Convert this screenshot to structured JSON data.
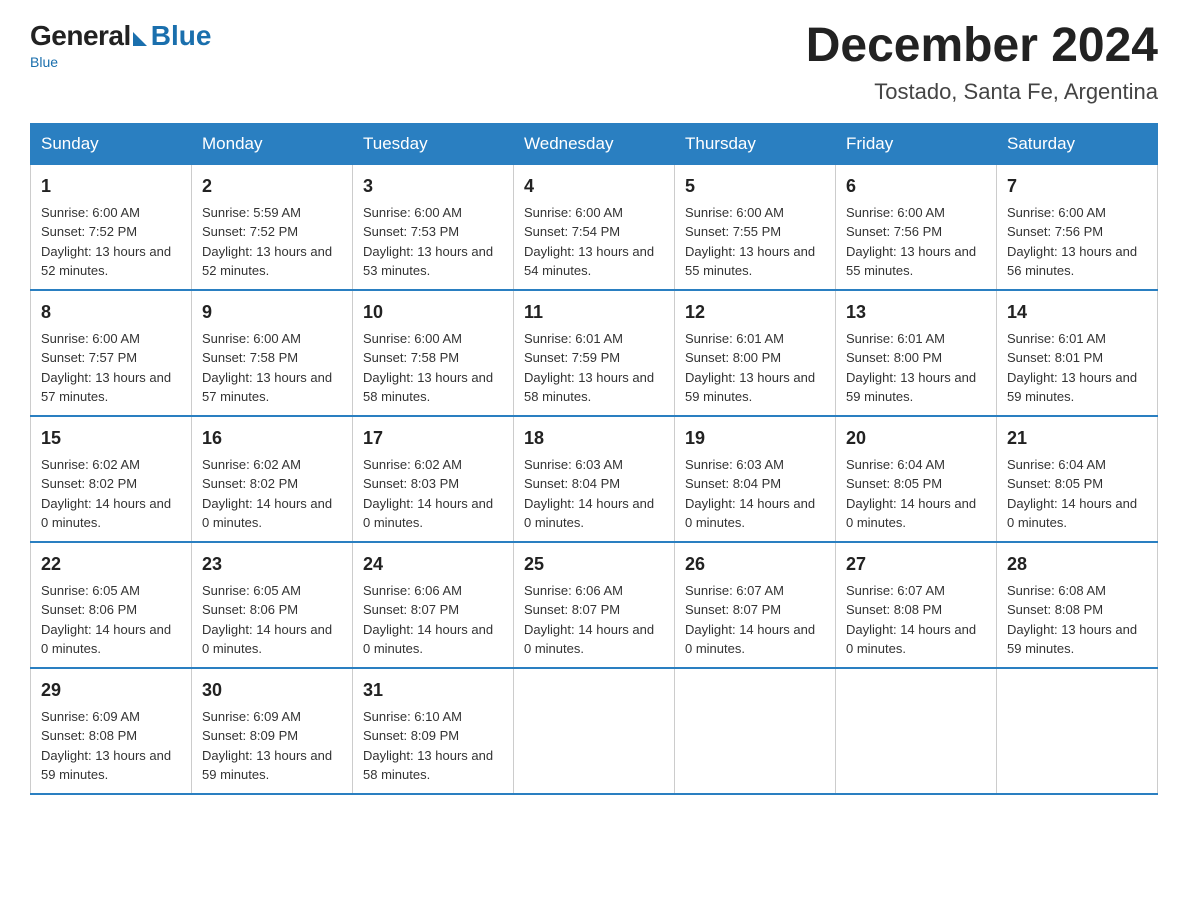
{
  "logo": {
    "general": "General",
    "blue": "Blue",
    "subtitle": "Blue"
  },
  "title": "December 2024",
  "subtitle": "Tostado, Santa Fe, Argentina",
  "days_of_week": [
    "Sunday",
    "Monday",
    "Tuesday",
    "Wednesday",
    "Thursday",
    "Friday",
    "Saturday"
  ],
  "weeks": [
    [
      {
        "day": "1",
        "sunrise": "Sunrise: 6:00 AM",
        "sunset": "Sunset: 7:52 PM",
        "daylight": "Daylight: 13 hours and 52 minutes."
      },
      {
        "day": "2",
        "sunrise": "Sunrise: 5:59 AM",
        "sunset": "Sunset: 7:52 PM",
        "daylight": "Daylight: 13 hours and 52 minutes."
      },
      {
        "day": "3",
        "sunrise": "Sunrise: 6:00 AM",
        "sunset": "Sunset: 7:53 PM",
        "daylight": "Daylight: 13 hours and 53 minutes."
      },
      {
        "day": "4",
        "sunrise": "Sunrise: 6:00 AM",
        "sunset": "Sunset: 7:54 PM",
        "daylight": "Daylight: 13 hours and 54 minutes."
      },
      {
        "day": "5",
        "sunrise": "Sunrise: 6:00 AM",
        "sunset": "Sunset: 7:55 PM",
        "daylight": "Daylight: 13 hours and 55 minutes."
      },
      {
        "day": "6",
        "sunrise": "Sunrise: 6:00 AM",
        "sunset": "Sunset: 7:56 PM",
        "daylight": "Daylight: 13 hours and 55 minutes."
      },
      {
        "day": "7",
        "sunrise": "Sunrise: 6:00 AM",
        "sunset": "Sunset: 7:56 PM",
        "daylight": "Daylight: 13 hours and 56 minutes."
      }
    ],
    [
      {
        "day": "8",
        "sunrise": "Sunrise: 6:00 AM",
        "sunset": "Sunset: 7:57 PM",
        "daylight": "Daylight: 13 hours and 57 minutes."
      },
      {
        "day": "9",
        "sunrise": "Sunrise: 6:00 AM",
        "sunset": "Sunset: 7:58 PM",
        "daylight": "Daylight: 13 hours and 57 minutes."
      },
      {
        "day": "10",
        "sunrise": "Sunrise: 6:00 AM",
        "sunset": "Sunset: 7:58 PM",
        "daylight": "Daylight: 13 hours and 58 minutes."
      },
      {
        "day": "11",
        "sunrise": "Sunrise: 6:01 AM",
        "sunset": "Sunset: 7:59 PM",
        "daylight": "Daylight: 13 hours and 58 minutes."
      },
      {
        "day": "12",
        "sunrise": "Sunrise: 6:01 AM",
        "sunset": "Sunset: 8:00 PM",
        "daylight": "Daylight: 13 hours and 59 minutes."
      },
      {
        "day": "13",
        "sunrise": "Sunrise: 6:01 AM",
        "sunset": "Sunset: 8:00 PM",
        "daylight": "Daylight: 13 hours and 59 minutes."
      },
      {
        "day": "14",
        "sunrise": "Sunrise: 6:01 AM",
        "sunset": "Sunset: 8:01 PM",
        "daylight": "Daylight: 13 hours and 59 minutes."
      }
    ],
    [
      {
        "day": "15",
        "sunrise": "Sunrise: 6:02 AM",
        "sunset": "Sunset: 8:02 PM",
        "daylight": "Daylight: 14 hours and 0 minutes."
      },
      {
        "day": "16",
        "sunrise": "Sunrise: 6:02 AM",
        "sunset": "Sunset: 8:02 PM",
        "daylight": "Daylight: 14 hours and 0 minutes."
      },
      {
        "day": "17",
        "sunrise": "Sunrise: 6:02 AM",
        "sunset": "Sunset: 8:03 PM",
        "daylight": "Daylight: 14 hours and 0 minutes."
      },
      {
        "day": "18",
        "sunrise": "Sunrise: 6:03 AM",
        "sunset": "Sunset: 8:04 PM",
        "daylight": "Daylight: 14 hours and 0 minutes."
      },
      {
        "day": "19",
        "sunrise": "Sunrise: 6:03 AM",
        "sunset": "Sunset: 8:04 PM",
        "daylight": "Daylight: 14 hours and 0 minutes."
      },
      {
        "day": "20",
        "sunrise": "Sunrise: 6:04 AM",
        "sunset": "Sunset: 8:05 PM",
        "daylight": "Daylight: 14 hours and 0 minutes."
      },
      {
        "day": "21",
        "sunrise": "Sunrise: 6:04 AM",
        "sunset": "Sunset: 8:05 PM",
        "daylight": "Daylight: 14 hours and 0 minutes."
      }
    ],
    [
      {
        "day": "22",
        "sunrise": "Sunrise: 6:05 AM",
        "sunset": "Sunset: 8:06 PM",
        "daylight": "Daylight: 14 hours and 0 minutes."
      },
      {
        "day": "23",
        "sunrise": "Sunrise: 6:05 AM",
        "sunset": "Sunset: 8:06 PM",
        "daylight": "Daylight: 14 hours and 0 minutes."
      },
      {
        "day": "24",
        "sunrise": "Sunrise: 6:06 AM",
        "sunset": "Sunset: 8:07 PM",
        "daylight": "Daylight: 14 hours and 0 minutes."
      },
      {
        "day": "25",
        "sunrise": "Sunrise: 6:06 AM",
        "sunset": "Sunset: 8:07 PM",
        "daylight": "Daylight: 14 hours and 0 minutes."
      },
      {
        "day": "26",
        "sunrise": "Sunrise: 6:07 AM",
        "sunset": "Sunset: 8:07 PM",
        "daylight": "Daylight: 14 hours and 0 minutes."
      },
      {
        "day": "27",
        "sunrise": "Sunrise: 6:07 AM",
        "sunset": "Sunset: 8:08 PM",
        "daylight": "Daylight: 14 hours and 0 minutes."
      },
      {
        "day": "28",
        "sunrise": "Sunrise: 6:08 AM",
        "sunset": "Sunset: 8:08 PM",
        "daylight": "Daylight: 13 hours and 59 minutes."
      }
    ],
    [
      {
        "day": "29",
        "sunrise": "Sunrise: 6:09 AM",
        "sunset": "Sunset: 8:08 PM",
        "daylight": "Daylight: 13 hours and 59 minutes."
      },
      {
        "day": "30",
        "sunrise": "Sunrise: 6:09 AM",
        "sunset": "Sunset: 8:09 PM",
        "daylight": "Daylight: 13 hours and 59 minutes."
      },
      {
        "day": "31",
        "sunrise": "Sunrise: 6:10 AM",
        "sunset": "Sunset: 8:09 PM",
        "daylight": "Daylight: 13 hours and 58 minutes."
      },
      null,
      null,
      null,
      null
    ]
  ]
}
